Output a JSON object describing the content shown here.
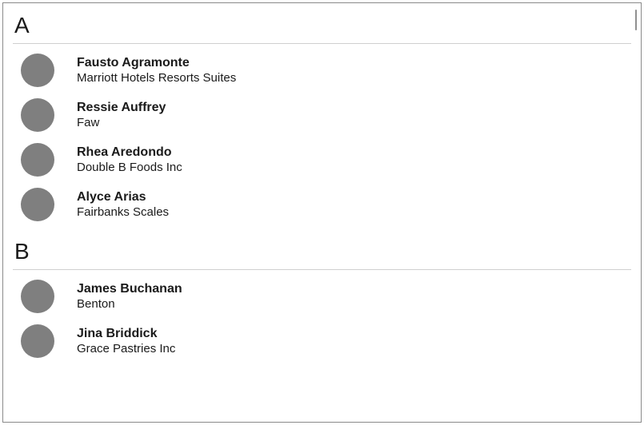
{
  "groups": [
    {
      "header": "A",
      "items": [
        {
          "name": "Fausto Agramonte",
          "company": "Marriott Hotels Resorts Suites"
        },
        {
          "name": "Ressie Auffrey",
          "company": "Faw"
        },
        {
          "name": "Rhea Aredondo",
          "company": "Double B Foods Inc"
        },
        {
          "name": "Alyce Arias",
          "company": "Fairbanks Scales"
        }
      ]
    },
    {
      "header": "B",
      "items": [
        {
          "name": "James Buchanan",
          "company": "Benton"
        },
        {
          "name": "Jina Briddick",
          "company": "Grace Pastries Inc"
        }
      ]
    }
  ]
}
